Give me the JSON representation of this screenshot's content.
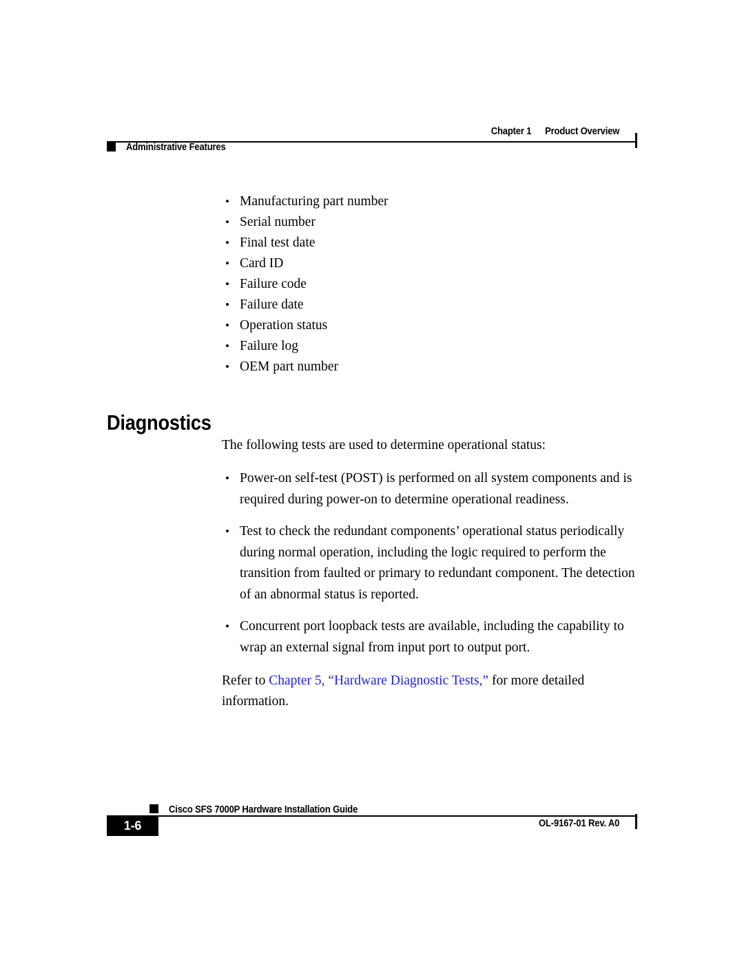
{
  "header": {
    "chapter_number": "Chapter 1",
    "chapter_title": "Product Overview",
    "section_label": "Administrative Features"
  },
  "attributes_list": {
    "items": [
      "Manufacturing part number",
      "Serial number",
      "Final test date",
      "Card ID",
      "Failure code",
      "Failure date",
      "Operation status",
      "Failure log",
      "OEM part number"
    ]
  },
  "diagnostics": {
    "heading": "Diagnostics",
    "intro": "The following tests are used to determine operational status:",
    "tests": [
      "Power-on self-test (POST) is performed on all system components and is required during power-on to determine operational readiness.",
      "Test to check the redundant components’ operational status periodically during normal operation, including the logic required to perform the transition from faulted or primary to redundant component. The detection of an abnormal status is reported.",
      "Concurrent port loopback tests are available, including the capability to wrap an external signal from input port to output port."
    ],
    "refer": {
      "prefix": "Refer to ",
      "link_text": "Chapter 5, “Hardware Diagnostic Tests,”",
      "suffix": " for more detailed information.",
      "link_color": "#2222dd"
    }
  },
  "footer": {
    "page_number": "1-6",
    "guide_title": "Cisco SFS 7000P Hardware Installation Guide",
    "document_id": "OL-9167-01 Rev. A0"
  }
}
